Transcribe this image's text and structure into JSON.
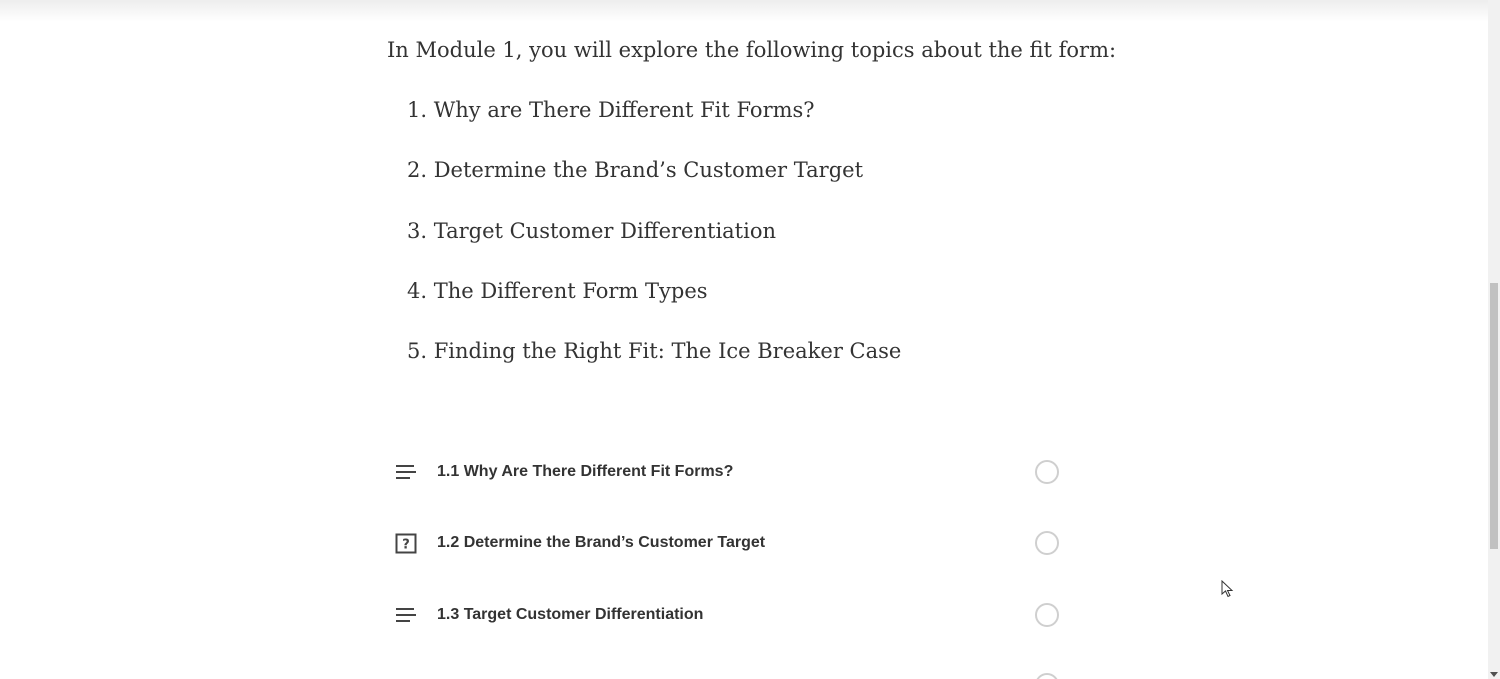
{
  "intro": {
    "text": "In Module 1, you will explore the following topics about the fit form:"
  },
  "topics": [
    {
      "number": "1.",
      "label": "Why are There Different Fit Forms?"
    },
    {
      "number": "2.",
      "label": "Determine the Brand’s Customer Target"
    },
    {
      "number": "3.",
      "label": "Target Customer Differentiation"
    },
    {
      "number": "4.",
      "label": "The Different Form Types"
    },
    {
      "number": "5.",
      "label": "Finding the Right Fit: The Ice Breaker Case"
    }
  ],
  "lessons": [
    {
      "label": "1.1 Why Are There Different Fit Forms?",
      "icon": "text-lines-icon",
      "completed": false
    },
    {
      "label": "1.2 Determine the Brand’s Customer Target",
      "icon": "quiz-icon",
      "completed": false
    },
    {
      "label": "1.3 Target Customer Differentiation",
      "icon": "text-lines-icon",
      "completed": false
    }
  ],
  "colors": {
    "text": "#333333",
    "circle": "#cfcfcf",
    "scrollbar_thumb": "#c1c1c1"
  }
}
